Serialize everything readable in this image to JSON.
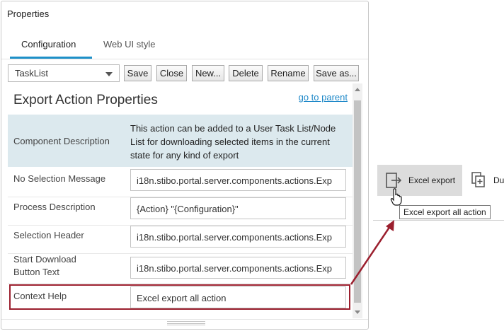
{
  "panel": {
    "title": "Properties",
    "tabs": [
      {
        "label": "Configuration",
        "active": true
      },
      {
        "label": "Web UI style",
        "active": false
      }
    ]
  },
  "toolbar": {
    "selected_config": "TaskList",
    "buttons": [
      "Save",
      "Close",
      "New...",
      "Delete",
      "Rename",
      "Save as..."
    ]
  },
  "section": {
    "title": "Export Action Properties",
    "parent_link": "go to parent"
  },
  "description": {
    "label": "Component Description",
    "text": "This action can be added to a User Task List/Node List for downloading selected items in the current state for any kind of export"
  },
  "properties": [
    {
      "label": "No Selection Message",
      "value": "i18n.stibo.portal.server.components.actions.Exp"
    },
    {
      "label": "Process Description",
      "value": "{Action} \"{Configuration}\""
    },
    {
      "label": "Selection Header",
      "value": "i18n.stibo.portal.server.components.actions.Exp"
    },
    {
      "label": "Start Download Button Text",
      "value": "i18n.stibo.portal.server.components.actions.Exp"
    },
    {
      "label": "Context Help",
      "value": "Excel export all action"
    }
  ],
  "preview": {
    "excel_button_label": "Excel export",
    "next_button_label": "Du",
    "tooltip": "Excel export all action"
  },
  "colors": {
    "accent": "#1e90c8",
    "highlight": "#9b1f2e",
    "description_bg": "#dce9ee"
  }
}
